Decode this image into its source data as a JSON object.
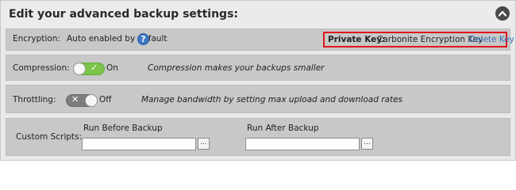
{
  "header": {
    "title": "Edit your advanced backup settings:",
    "collapse_icon": "chevron-up-icon"
  },
  "encryption": {
    "label": "Encryption:",
    "value": "Auto enabled by default",
    "help_icon": "help-icon",
    "help_glyph": "?",
    "private_key_label": "Private Key:",
    "private_key_value": "Carbonite Encryption Key",
    "delete_link": "Delete Key",
    "highlight_color": "#e0141c"
  },
  "compression": {
    "label": "Compression:",
    "toggle_state": "On",
    "toggle_on": true,
    "description": "Compression makes your backups smaller",
    "toggle_color": "#7cc349"
  },
  "throttling": {
    "label": "Throttling:",
    "toggle_state": "Off",
    "toggle_on": false,
    "description": "Manage bandwidth by setting max upload and download rates"
  },
  "scripts": {
    "label": "Custom Scripts:",
    "before_label": "Run Before Backup",
    "before_value": "",
    "after_label": "Run After Backup",
    "after_value": "",
    "browse_label": "..."
  }
}
